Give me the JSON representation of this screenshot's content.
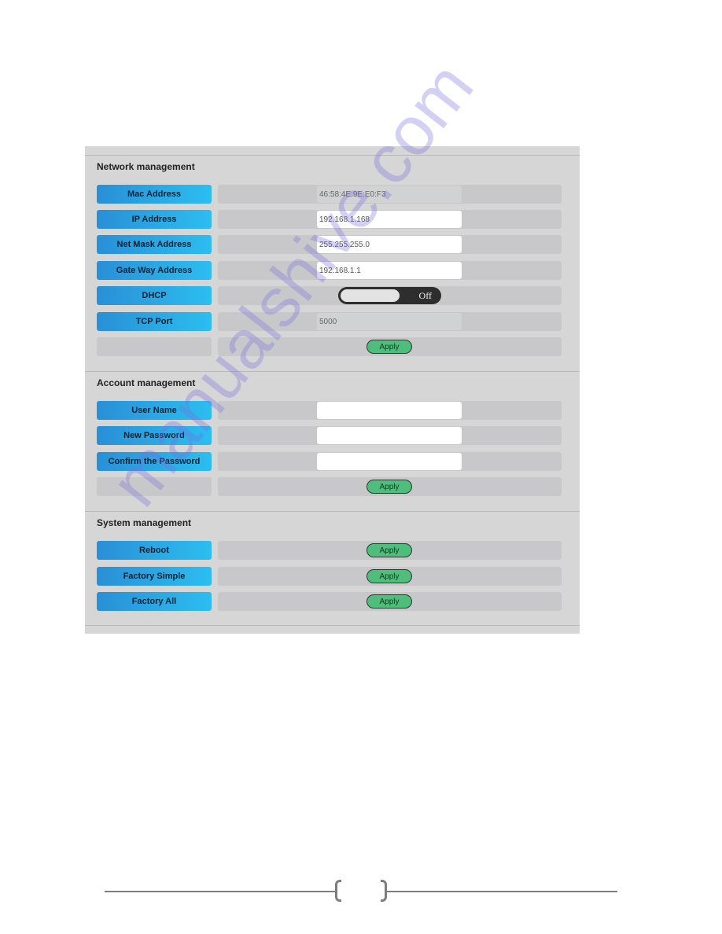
{
  "network": {
    "title": "Network management",
    "rows": [
      {
        "label": "Mac Address",
        "value": "46:58:4E:9E:E0:F3",
        "readonly": true
      },
      {
        "label": "IP Address",
        "value": "192.168.1.168"
      },
      {
        "label": "Net Mask Address",
        "value": "255.255.255.0"
      },
      {
        "label": "Gate Way Address",
        "value": "192.168.1.1"
      },
      {
        "label": "DHCP",
        "toggle_state": "Off"
      },
      {
        "label": "TCP Port",
        "value": "5000",
        "readonly": true
      }
    ],
    "apply_label": "Apply"
  },
  "account": {
    "title": "Account management",
    "rows": [
      {
        "label": "User Name",
        "value": ""
      },
      {
        "label": "New Password",
        "value": ""
      },
      {
        "label": "Confirm the Password",
        "value": ""
      }
    ],
    "apply_label": "Apply"
  },
  "system": {
    "title": "System management",
    "rows": [
      {
        "label": "Reboot",
        "apply_label": "Apply"
      },
      {
        "label": "Factory Simple",
        "apply_label": "Apply"
      },
      {
        "label": "Factory All",
        "apply_label": "Apply"
      }
    ]
  },
  "colors": {
    "label_gradient_start": "#2a8fd6",
    "label_gradient_end": "#2cbef0",
    "apply_button": "#4fbd7b",
    "panel_bg": "#d6d6d6",
    "cell_bg": "#c8c8ca"
  },
  "watermark": "manualshive.com"
}
